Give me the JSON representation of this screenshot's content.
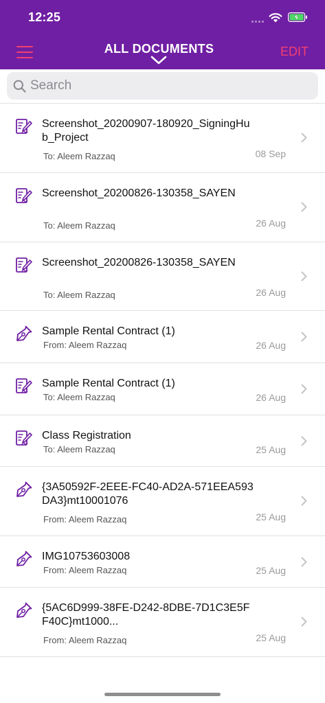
{
  "status_bar": {
    "time": "12:25"
  },
  "header": {
    "title": "ALL DOCUMENTS",
    "edit_label": "EDIT"
  },
  "search": {
    "placeholder": "Search"
  },
  "colors": {
    "header_bg": "#6f1fa3",
    "accent": "#f43f71",
    "icon": "#6f1fa3"
  },
  "documents": [
    {
      "title": "Screenshot_20200907-180920_SigningHub_Project",
      "subtitle": "To: Aleem Razzaq",
      "date": "08 Sep",
      "icon": "document-sign-icon"
    },
    {
      "title": "Screenshot_20200826-130358_SAYEN",
      "subtitle": "To: Aleem Razzaq",
      "date": "26 Aug",
      "icon": "document-sign-icon"
    },
    {
      "title": "Screenshot_20200826-130358_SAYEN",
      "subtitle": "To: Aleem Razzaq",
      "date": "26 Aug",
      "icon": "document-sign-icon"
    },
    {
      "title": "Sample Rental Contract (1)",
      "subtitle": "From: Aleem Razzaq",
      "date": "26 Aug",
      "icon": "pen-nib-icon"
    },
    {
      "title": "Sample Rental Contract (1)",
      "subtitle": "To: Aleem Razzaq",
      "date": "26 Aug",
      "icon": "document-sign-icon"
    },
    {
      "title": "Class Registration",
      "subtitle": "To: Aleem Razzaq",
      "date": "25 Aug",
      "icon": "document-sign-icon"
    },
    {
      "title": "{3A50592F-2EEE-FC40-AD2A-571EEA593DA3}mt10001076",
      "subtitle": "From: Aleem Razzaq",
      "date": "25 Aug",
      "icon": "pen-nib-icon"
    },
    {
      "title": "IMG10753603008",
      "subtitle": "From: Aleem Razzaq",
      "date": "25 Aug",
      "icon": "pen-nib-icon"
    },
    {
      "title": "{5AC6D999-38FE-D242-8DBE-7D1C3E5FF40C}mt1000...",
      "subtitle": "From: Aleem Razzaq",
      "date": "25 Aug",
      "icon": "pen-nib-icon"
    }
  ]
}
